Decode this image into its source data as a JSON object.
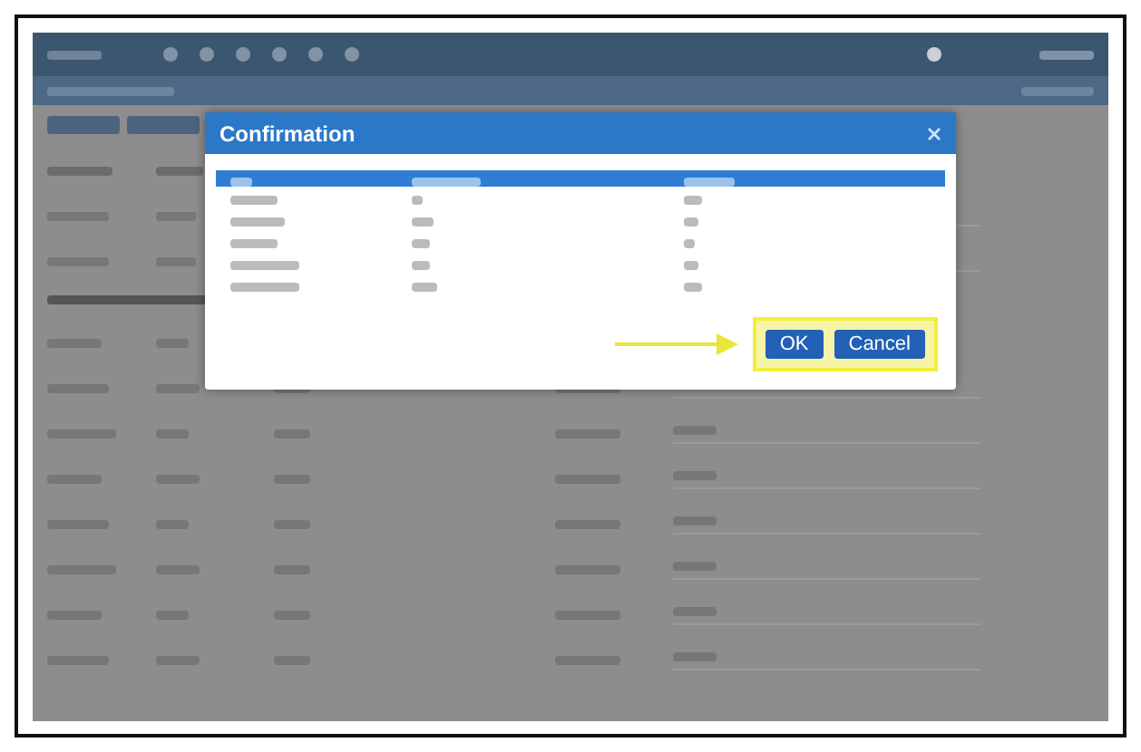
{
  "dialog": {
    "title": "Confirmation",
    "buttons": [
      {
        "label": "OK",
        "kind": "primary"
      },
      {
        "label": "Cancel",
        "kind": "primary"
      }
    ]
  }
}
